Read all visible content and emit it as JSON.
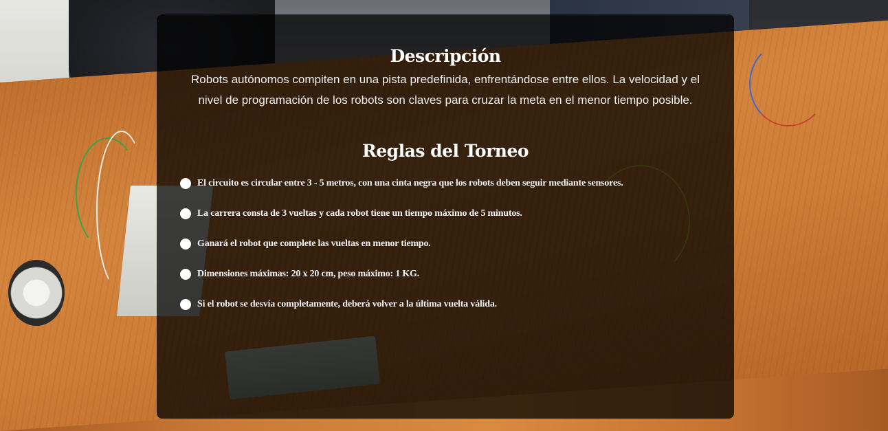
{
  "description": {
    "title": "Descripción",
    "text": "Robots autónomos compiten en una pista predefinida, enfrentándose entre ellos. La velocidad y el nivel de programación de los robots son claves para cruzar la meta en el menor tiempo posible."
  },
  "rules": {
    "title": "Reglas del Torneo",
    "items": [
      "El circuito es circular entre 3 - 5 metros, con una cinta negra que los robots deben seguir mediante sensores.",
      "La carrera consta de 3 vueltas y cada robot tiene un tiempo máximo de 5 minutos.",
      "Ganará el robot que complete las vueltas en menor tiempo.",
      "Dimensiones máximas: 20 x 20 cm, peso máximo: 1 KG.",
      "Si el robot se desvía completamente, deberá volver a la última vuelta válida."
    ]
  },
  "colors": {
    "panel_background": "#000000",
    "text": "#ffffff",
    "bullet": "#ffffff"
  }
}
